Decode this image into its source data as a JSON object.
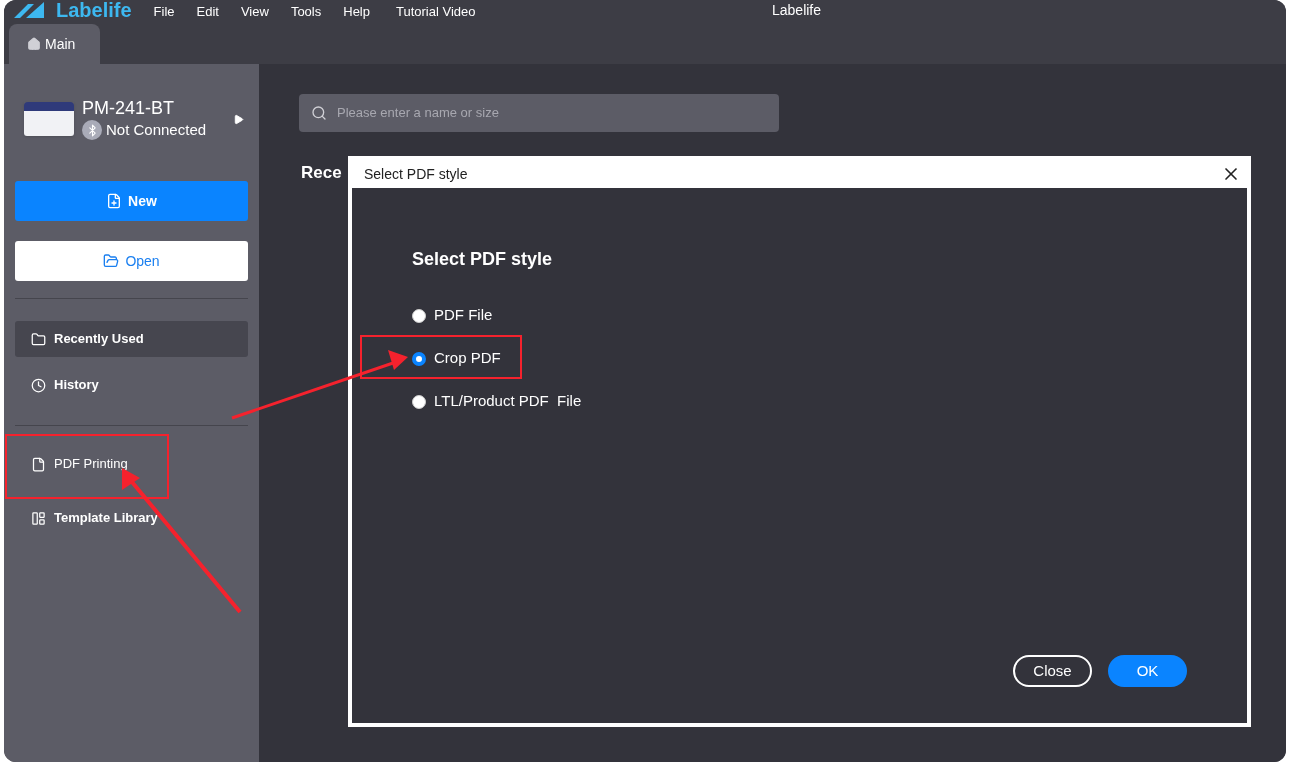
{
  "app": {
    "logo": "Labelife",
    "title": "Labelife",
    "menu": [
      "File",
      "Edit",
      "View",
      "Tools",
      "Help",
      "Tutorial Video"
    ]
  },
  "tabs": [
    {
      "label": "Main",
      "selected": true
    }
  ],
  "device": {
    "name": "PM-241-BT",
    "status": "Not Connected"
  },
  "actions": [
    {
      "label": "New",
      "kind": "primary"
    },
    {
      "label": "Open",
      "kind": "secondary"
    }
  ],
  "nav_groups": [
    [
      {
        "label": "Recently Used",
        "selected": true
      },
      {
        "label": "History",
        "selected": false
      }
    ],
    [
      {
        "label": "PDF Printing",
        "selected": false
      },
      {
        "label": "Template Library",
        "selected": false
      }
    ]
  ],
  "search": {
    "placeholder": "Please enter a name or size"
  },
  "section_title": "Rece",
  "dialog": {
    "title": "Select PDF style",
    "heading": "Select PDF style",
    "options": [
      {
        "label": "PDF File",
        "selected": false
      },
      {
        "label": "Crop PDF",
        "selected": true
      },
      {
        "label": "LTL/Product PDF  File",
        "selected": false
      }
    ],
    "buttons": [
      {
        "label": "Close",
        "kind": "secondary"
      },
      {
        "label": "OK",
        "kind": "primary"
      }
    ]
  }
}
